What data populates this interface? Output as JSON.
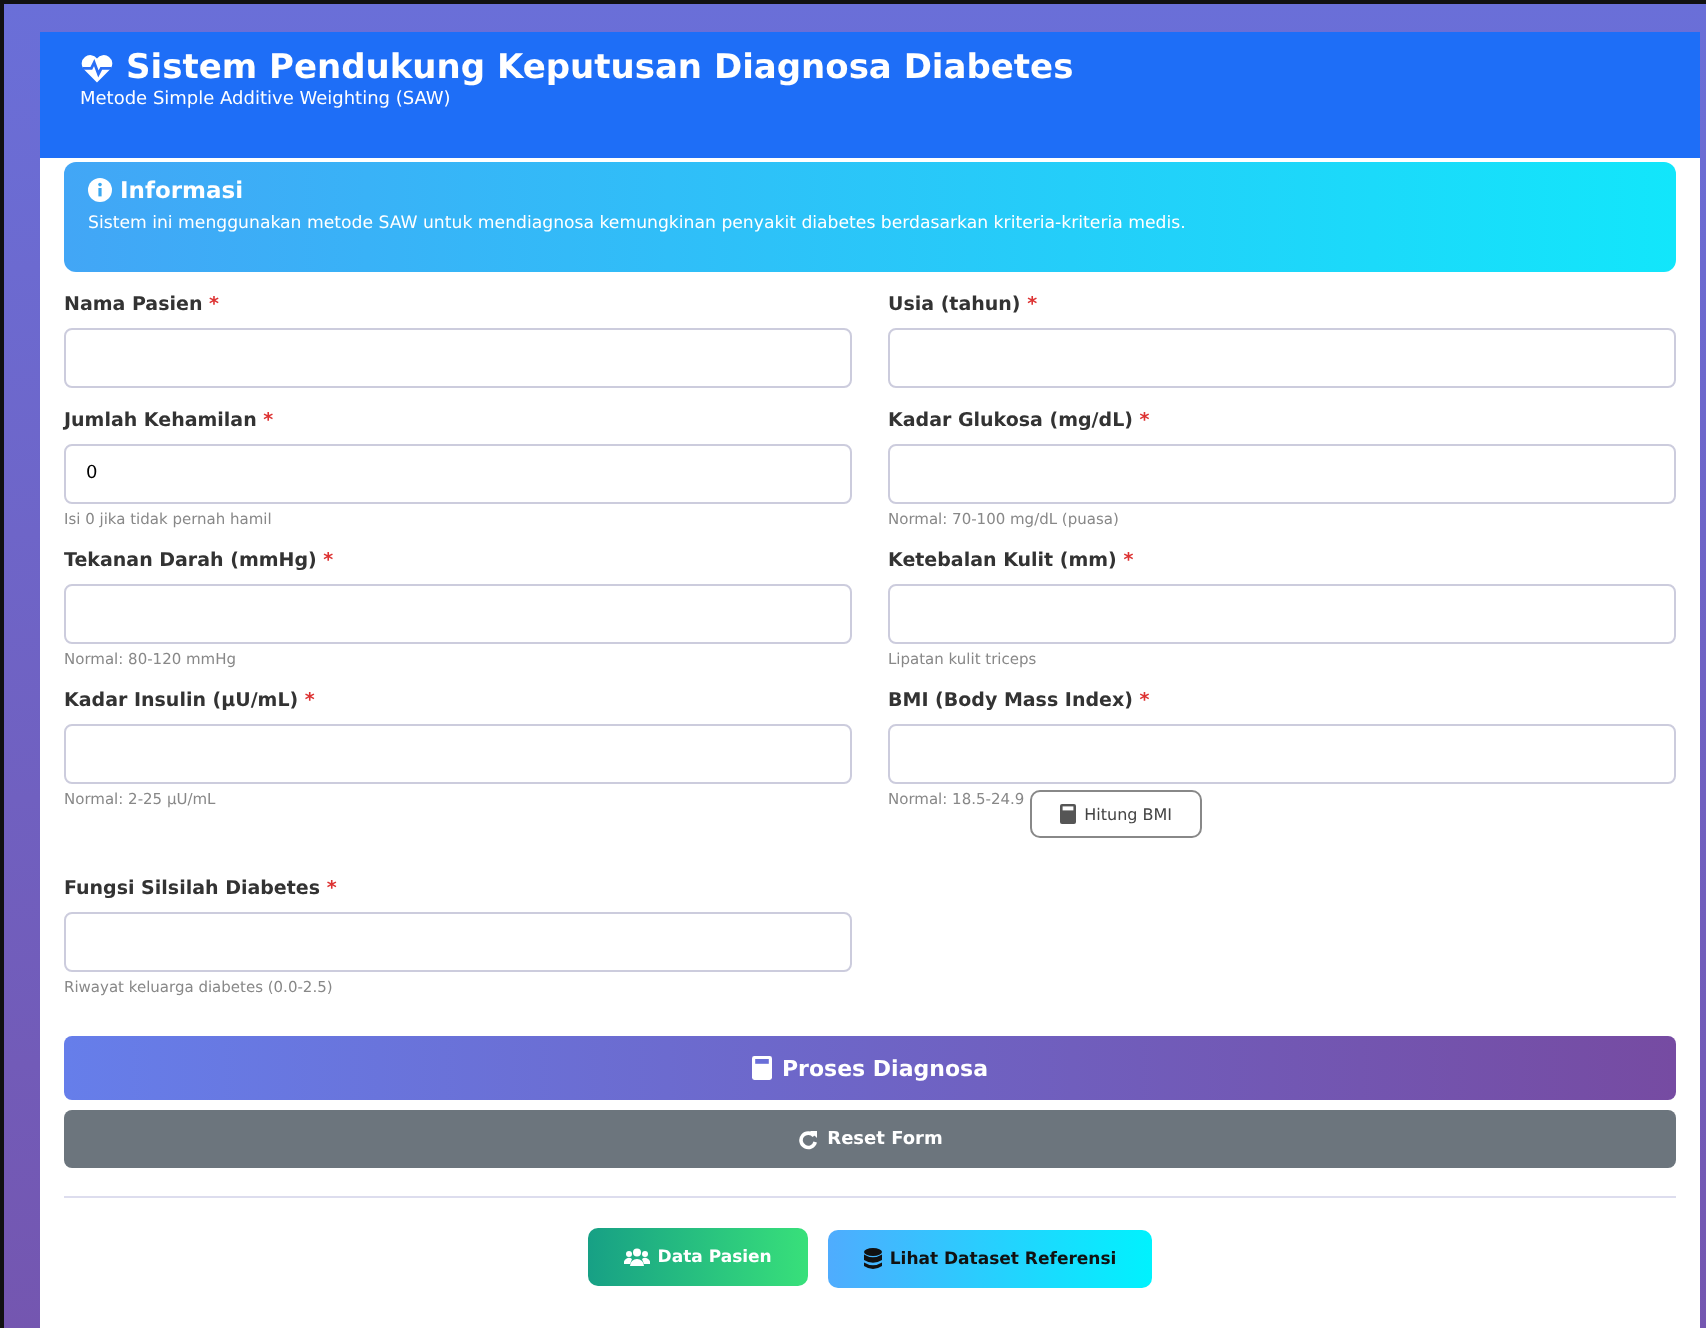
{
  "header": {
    "title": "Sistem Pendukung Keputusan Diagnosa Diabetes",
    "subtitle": "Metode Simple Additive Weighting (SAW)"
  },
  "info": {
    "title": "Informasi",
    "text": "Sistem ini menggunakan metode SAW untuk mendiagnosa kemungkinan penyakit diabetes berdasarkan kriteria-kriteria medis."
  },
  "rows": [
    [
      {
        "label": "Nama Pasien",
        "required": "*"
      },
      {
        "label": "Usia (tahun)",
        "required": "*"
      }
    ],
    [
      {
        "label": "Jumlah Kehamilan",
        "required": "*",
        "value": "0",
        "hint": "Isi 0 jika tidak pernah hamil"
      },
      {
        "label": "Kadar Glukosa (mg/dL)",
        "required": "*",
        "hint": "Normal: 70-100 mg/dL (puasa)"
      }
    ],
    [
      {
        "label": "Tekanan Darah (mmHg)",
        "required": "*",
        "hint": "Normal: 80-120 mmHg"
      },
      {
        "label": "Ketebalan Kulit (mm)",
        "required": "*",
        "hint": "Lipatan kulit triceps"
      }
    ],
    [
      {
        "label": "Kadar Insulin (µU/mL)",
        "required": "*",
        "hint": "Normal: 2-25 µU/mL"
      },
      {
        "label": "BMI (Body Mass Index)",
        "required": "*",
        "hint": "Normal: 18.5-24.9",
        "button": "Hitung BMI"
      }
    ],
    [
      {
        "label": "Fungsi Silsilah Diabetes",
        "required": "*",
        "hint": "Riwayat keluarga diabetes (0.0-2.5)"
      }
    ]
  ],
  "actions": [
    {
      "label": "Proses Diagnosa",
      "kind": "primary"
    },
    {
      "label": "Reset Form",
      "kind": "secondary"
    }
  ],
  "links": [
    {
      "label": "Data Pasien",
      "kind": "success"
    },
    {
      "label": "Lihat Dataset Referensi",
      "kind": "info"
    }
  ]
}
